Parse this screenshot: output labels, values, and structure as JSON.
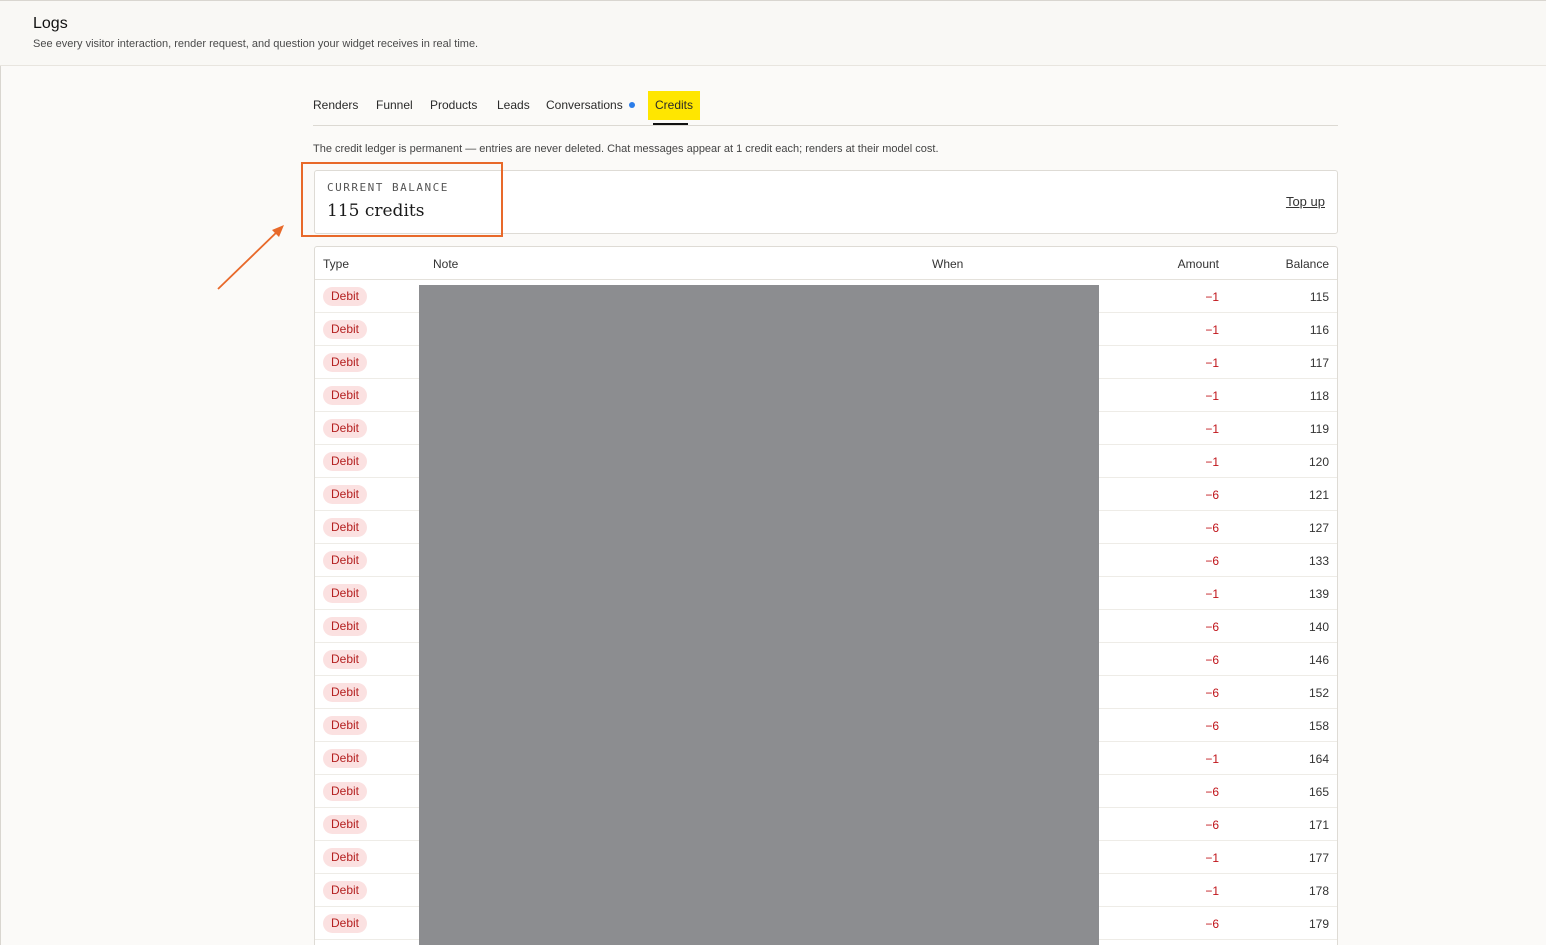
{
  "header": {
    "title": "Logs",
    "subtitle": "See every visitor interaction, render request, and question your widget receives in real time."
  },
  "tabs": [
    {
      "label": "Renders"
    },
    {
      "label": "Funnel"
    },
    {
      "label": "Products"
    },
    {
      "label": "Leads"
    },
    {
      "label": "Conversations"
    },
    {
      "label": "Credits"
    }
  ],
  "ledger_note": "The credit ledger is permanent — entries are never deleted. Chat messages appear at 1 credit each; renders at their model cost.",
  "balance": {
    "label": "CURRENT BALANCE",
    "value": "115 credits",
    "topup_label": "Top up"
  },
  "table": {
    "columns": {
      "type": "Type",
      "note": "Note",
      "when": "When",
      "amount": "Amount",
      "balance": "Balance"
    },
    "rows": [
      {
        "type": "Debit",
        "note": "",
        "when": "",
        "amount": "−1",
        "balance": "115"
      },
      {
        "type": "Debit",
        "note": "",
        "when": "",
        "amount": "−1",
        "balance": "116"
      },
      {
        "type": "Debit",
        "note": "",
        "when": "",
        "amount": "−1",
        "balance": "117"
      },
      {
        "type": "Debit",
        "note": "",
        "when": "",
        "amount": "−1",
        "balance": "118"
      },
      {
        "type": "Debit",
        "note": "",
        "when": "",
        "amount": "−1",
        "balance": "119"
      },
      {
        "type": "Debit",
        "note": "",
        "when": "",
        "amount": "−1",
        "balance": "120"
      },
      {
        "type": "Debit",
        "note": "",
        "when": "",
        "amount": "−6",
        "balance": "121"
      },
      {
        "type": "Debit",
        "note": "",
        "when": "",
        "amount": "−6",
        "balance": "127"
      },
      {
        "type": "Debit",
        "note": "",
        "when": "",
        "amount": "−6",
        "balance": "133"
      },
      {
        "type": "Debit",
        "note": "",
        "when": "",
        "amount": "−1",
        "balance": "139"
      },
      {
        "type": "Debit",
        "note": "",
        "when": "",
        "amount": "−6",
        "balance": "140"
      },
      {
        "type": "Debit",
        "note": "",
        "when": "",
        "amount": "−6",
        "balance": "146"
      },
      {
        "type": "Debit",
        "note": "",
        "when": "",
        "amount": "−6",
        "balance": "152"
      },
      {
        "type": "Debit",
        "note": "",
        "when": "",
        "amount": "−6",
        "balance": "158"
      },
      {
        "type": "Debit",
        "note": "",
        "when": "",
        "amount": "−1",
        "balance": "164"
      },
      {
        "type": "Debit",
        "note": "",
        "when": "",
        "amount": "−6",
        "balance": "165"
      },
      {
        "type": "Debit",
        "note": "",
        "when": "",
        "amount": "−6",
        "balance": "171"
      },
      {
        "type": "Debit",
        "note": "",
        "when": "",
        "amount": "−1",
        "balance": "177"
      },
      {
        "type": "Debit",
        "note": "",
        "when": "",
        "amount": "−1",
        "balance": "178"
      },
      {
        "type": "Debit",
        "note": "",
        "when": "",
        "amount": "−6",
        "balance": "179"
      }
    ]
  },
  "colors": {
    "active_tab_highlight": "#ffe600",
    "debit_badge_bg": "#fbe1e1",
    "debit_text": "#b42020",
    "amount_negative": "#c0141a",
    "annotation_orange": "#e8692a",
    "redaction_gray": "#8a8b8e",
    "conversations_dot": "#2b7de9"
  }
}
